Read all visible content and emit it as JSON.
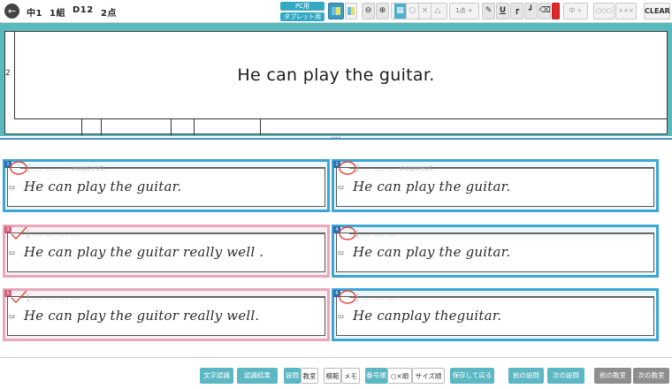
{
  "header": {
    "back_icon": "back-arrow-icon",
    "grade": "中1",
    "class": "1組",
    "label": "D12",
    "score": "2点",
    "mode_pc": "PC用",
    "mode_tablet": "タブレット用",
    "zoom_out_icon": "zoom-out-icon",
    "zoom_in_icon": "zoom-in-icon",
    "mark_circle": "○",
    "mark_cross": "×",
    "mark_triangle": "△",
    "points_select": "1点 ÷",
    "size_select": "中 ÷",
    "circles": "○○○",
    "crosses": "×××",
    "clear": "CLEAR",
    "zoom_level": 0.68
  },
  "question": {
    "number": "2",
    "sentence": "He can play the guitar."
  },
  "answers": [
    {
      "index": "1",
      "q": "Q2",
      "text": "He  can  play   the  guitar.",
      "ghost": "ʃ ... ... ... concert.",
      "mark": "circle",
      "highlight": "blue"
    },
    {
      "index": "2",
      "q": "Q2",
      "text": "He  can play   the  guitar.",
      "ghost": "ʃ ... ... ... concert.",
      "mark": "circle",
      "highlight": "blue"
    },
    {
      "index": "3",
      "q": "Q2",
      "text": "He  can play the guitar  really well .",
      "ghost": "ʃ ... ... ... ...",
      "mark": "check",
      "highlight": "pink"
    },
    {
      "index": "4",
      "q": "Q2",
      "text": "He  can  play  the guitar.",
      "ghost": "ʃ ... ... ...",
      "mark": "circle",
      "highlight": "blue"
    },
    {
      "index": "5",
      "q": "Q2",
      "text": "He can play  the  guitor  really  well.",
      "ghost": "ʃ ... ... ... ...",
      "mark": "check",
      "highlight": "pink"
    },
    {
      "index": "6",
      "q": "Q2",
      "text": "He canplay  theguitar.",
      "ghost": "ʃ ... ... ...",
      "mark": "circle",
      "highlight": "blue"
    }
  ],
  "footer": {
    "btn_text_recognition": "文字認識",
    "btn_recognition_result": "認識結果",
    "btn_set_question": "設問",
    "btn_classroom": "教室",
    "btn_model": "模範",
    "btn_memo": "メモ",
    "btn_number_order": "番号順",
    "btn_circle_cross_order": "○×順",
    "btn_size_order": "サイズ順",
    "btn_save_return": "保存して戻る",
    "btn_prev_question": "前の設問",
    "btn_next_question": "次の設問",
    "btn_prev_classroom": "前の教室",
    "btn_next_classroom": "次の教室"
  },
  "colors": {
    "accent": "#5ab9bd",
    "card_blue": "#3ca6d6",
    "card_pink": "#e9a8ba",
    "mark_red": "#e0453a",
    "pen_red": "#e02a2a"
  }
}
